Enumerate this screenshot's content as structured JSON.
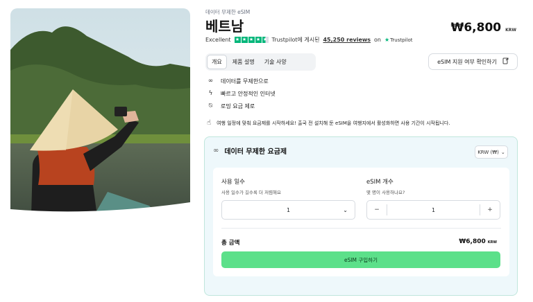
{
  "breadcrumb": "데이터 무제한 eSIM",
  "title": "베트남",
  "price": {
    "amount": "₩6,800",
    "currency": "KRW"
  },
  "rating": {
    "label": "Excellent",
    "stars": 4.5,
    "trustpilot_text": "Trustpilot에 게시된",
    "reviews": "45,250 reviews",
    "on": "on",
    "trustpilot_logo": "Trustpilot"
  },
  "tabs": [
    {
      "label": "개요",
      "active": true
    },
    {
      "label": "제품 설명",
      "active": false
    },
    {
      "label": "기술 사양",
      "active": false
    }
  ],
  "check_compat": {
    "label": "eSIM 지원 여부 확인하기",
    "icon": "external-doc-icon"
  },
  "features": [
    {
      "icon": "infinity-icon",
      "label": "데이터를 무제한으로"
    },
    {
      "icon": "lightning-icon",
      "label": "빠르고 안정적인 인터넷"
    },
    {
      "icon": "no-signal-icon",
      "label": "로밍 요금 제로"
    }
  ],
  "notice": {
    "icon": "hand-tap-icon",
    "text": "여행 일정에 맞춰 요금제를 시작하세요! 출국 전 설치해 둔 eSIM을 여행지에서 활성화하면 사용 기간이 시작됩니다."
  },
  "plan": {
    "title": "데이터 무제한 요금제",
    "currency_select": "KRW (₩)",
    "days": {
      "label": "사용 일수",
      "sub": "사용 일수가 길수록 더 저렴해요",
      "value": "1"
    },
    "esim_count": {
      "label": "eSIM 개수",
      "sub": "몇 명이 사용하나요?",
      "value": "1",
      "minus": "−",
      "plus": "+"
    },
    "total_label": "총 금액",
    "total_amount": "₩6,800",
    "total_currency": "KRW",
    "buy_label": "eSIM 구입하기"
  },
  "colors": {
    "accent_green": "#5ce08a",
    "trustpilot_green": "#00b67a",
    "card_bg": "#eef8fb"
  }
}
